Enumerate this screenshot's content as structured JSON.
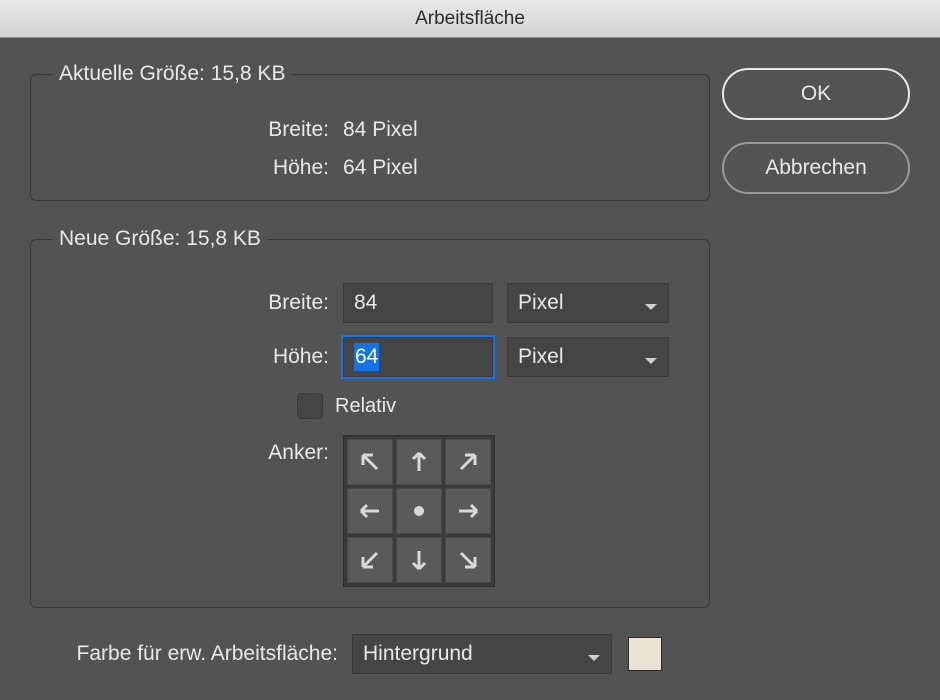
{
  "title": "Arbeitsfläche",
  "buttons": {
    "ok": "OK",
    "cancel": "Abbrechen"
  },
  "current": {
    "legend": "Aktuelle Größe: 15,8 KB",
    "width_label": "Breite:",
    "width_value": "84 Pixel",
    "height_label": "Höhe:",
    "height_value": "64 Pixel"
  },
  "new": {
    "legend": "Neue Größe: 15,8 KB",
    "width_label": "Breite:",
    "width_value": "84",
    "width_unit": "Pixel",
    "height_label": "Höhe:",
    "height_value": "64",
    "height_unit": "Pixel",
    "relative_label": "Relativ",
    "anchor_label": "Anker:"
  },
  "extension": {
    "label": "Farbe für erw. Arbeitsfläche:",
    "value": "Hintergrund",
    "swatch_color": "#e9e4d4"
  }
}
